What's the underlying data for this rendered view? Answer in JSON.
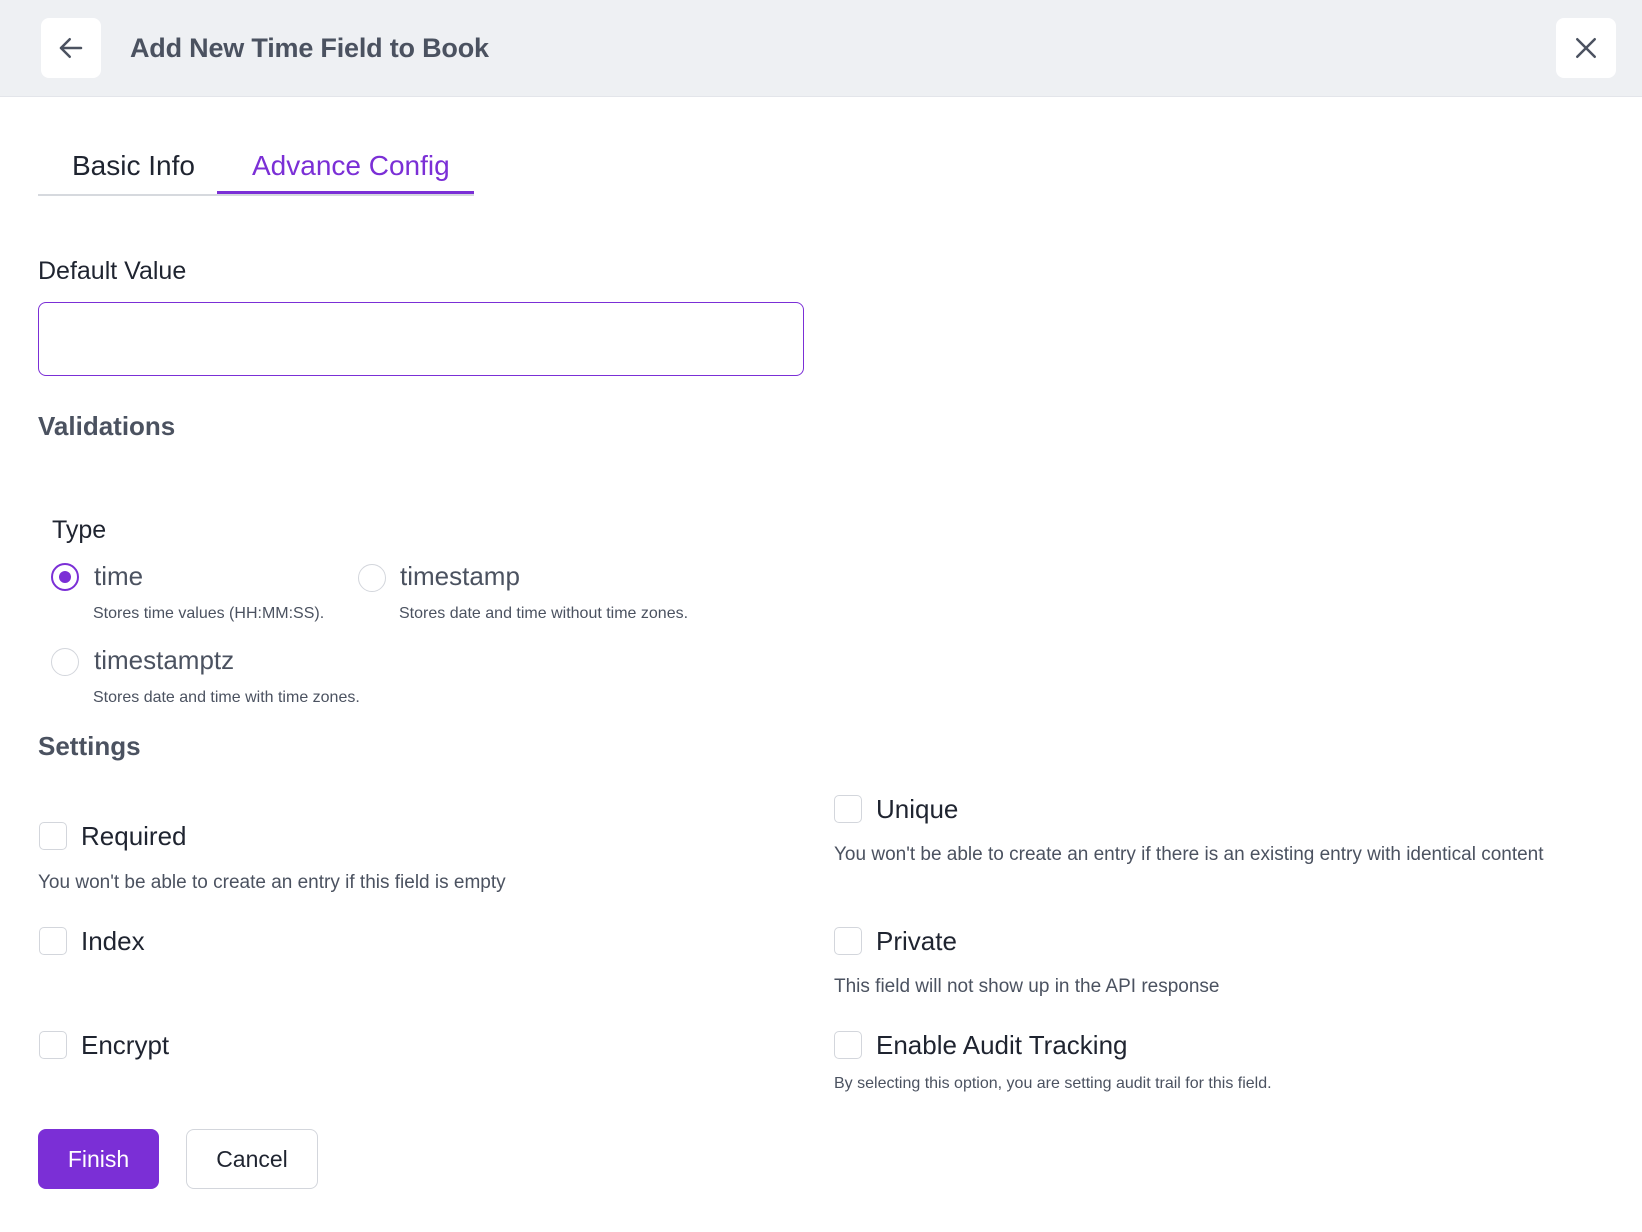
{
  "header": {
    "title": "Add New Time Field to Book",
    "back_icon": "arrow-left-icon",
    "close_icon": "close-icon"
  },
  "tabs": [
    {
      "label": "Basic Info",
      "active": false
    },
    {
      "label": "Advance Config",
      "active": true
    }
  ],
  "default_value": {
    "label": "Default Value",
    "value": "",
    "placeholder": ""
  },
  "validations": {
    "title": "Validations",
    "type_label": "Type",
    "options": [
      {
        "label": "time",
        "description": "Stores time values (HH:MM:SS).",
        "selected": true
      },
      {
        "label": "timestamp",
        "description": "Stores date and time without time zones.",
        "selected": false
      },
      {
        "label": "timestamptz",
        "description": "Stores date and time with time zones.",
        "selected": false
      }
    ]
  },
  "settings": {
    "title": "Settings",
    "required": {
      "label": "Required",
      "description": "You won't be able to create an entry if this field is empty",
      "checked": false
    },
    "unique": {
      "label": "Unique",
      "description": "You won't be able to create an entry if there is an existing entry with identical content",
      "checked": false
    },
    "index": {
      "label": "Index",
      "checked": false
    },
    "private": {
      "label": "Private",
      "description": "This field will not show up in the API response",
      "checked": false
    },
    "encrypt": {
      "label": "Encrypt",
      "checked": false
    },
    "audit": {
      "label": "Enable Audit Tracking",
      "description": "By selecting this option, you are setting audit trail for this field.",
      "checked": false
    }
  },
  "actions": {
    "finish_label": "Finish",
    "cancel_label": "Cancel"
  },
  "colors": {
    "accent": "#7b2fd6",
    "header_bg": "#eef0f3"
  }
}
